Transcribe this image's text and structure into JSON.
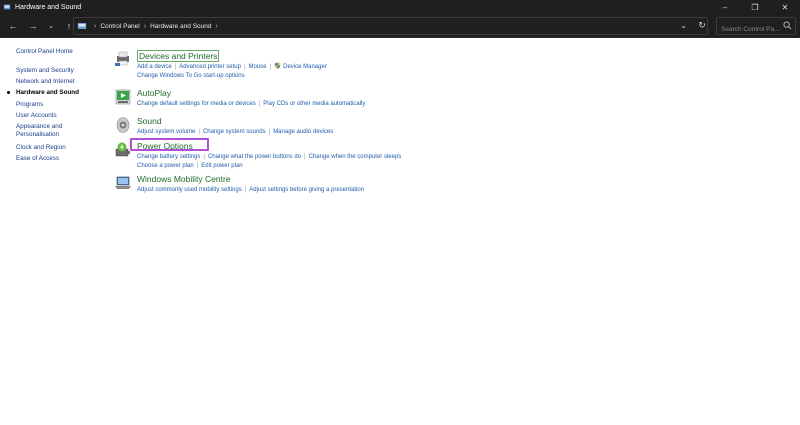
{
  "window": {
    "title": "Hardware and Sound",
    "icon": "control-panel-icon",
    "controls": [
      "minimize-icon",
      "restore-icon",
      "close-icon"
    ]
  },
  "nav": {
    "back": "back-arrow-icon",
    "forward": "forward-arrow-icon",
    "recent": "chevron-down-icon",
    "up": "up-arrow-icon",
    "breadcrumb": [
      "Control Panel",
      "Hardware and Sound"
    ],
    "refresh": "refresh-icon",
    "search_placeholder": "Search Control Pa..."
  },
  "sidebar": {
    "home": "Control Panel Home",
    "items": [
      {
        "label": "System and Security",
        "current": false
      },
      {
        "label": "Network and Internet",
        "current": false
      },
      {
        "label": "Hardware and Sound",
        "current": true
      },
      {
        "label": "Programs",
        "current": false
      },
      {
        "label": "User Accounts",
        "current": false
      },
      {
        "label": "Appearance and",
        "label2": "Personalisation",
        "current": false
      },
      {
        "label": "Clock and Region",
        "current": false
      },
      {
        "label": "Ease of Access",
        "current": false
      }
    ]
  },
  "categories": [
    {
      "title": "Devices and Printers",
      "icon": "printer-icon",
      "line1": [
        "Add a device",
        "Advanced printer setup",
        "Mouse",
        "Device Manager"
      ],
      "line2": [
        "Change Windows To Go start-up options"
      ]
    },
    {
      "title": "AutoPlay",
      "icon": "autoplay-icon",
      "line1": [
        "Change default settings for media or devices",
        "Play CDs or other media automatically"
      ],
      "line2": []
    },
    {
      "title": "Sound",
      "icon": "speaker-icon",
      "line1": [
        "Adjust system volume",
        "Change system sounds",
        "Manage audio devices"
      ],
      "line2": []
    },
    {
      "title": "Power Options",
      "icon": "power-options-icon",
      "line1": [
        "Change battery settings",
        "Change what the power buttons do",
        "Change when the computer sleeps"
      ],
      "line2": [
        "Choose a power plan",
        "Edit power plan"
      ]
    },
    {
      "title": "Windows Mobility Centre",
      "icon": "mobility-centre-icon",
      "line1": [
        "Adjust commonly used mobility settings",
        "Adjust settings before giving a presentation"
      ],
      "line2": []
    }
  ],
  "colors": {
    "titlebar": "#1f1f1f",
    "category_title": "#1e6b2c",
    "link": "#1f5cad",
    "highlight": "#b34fd6"
  }
}
